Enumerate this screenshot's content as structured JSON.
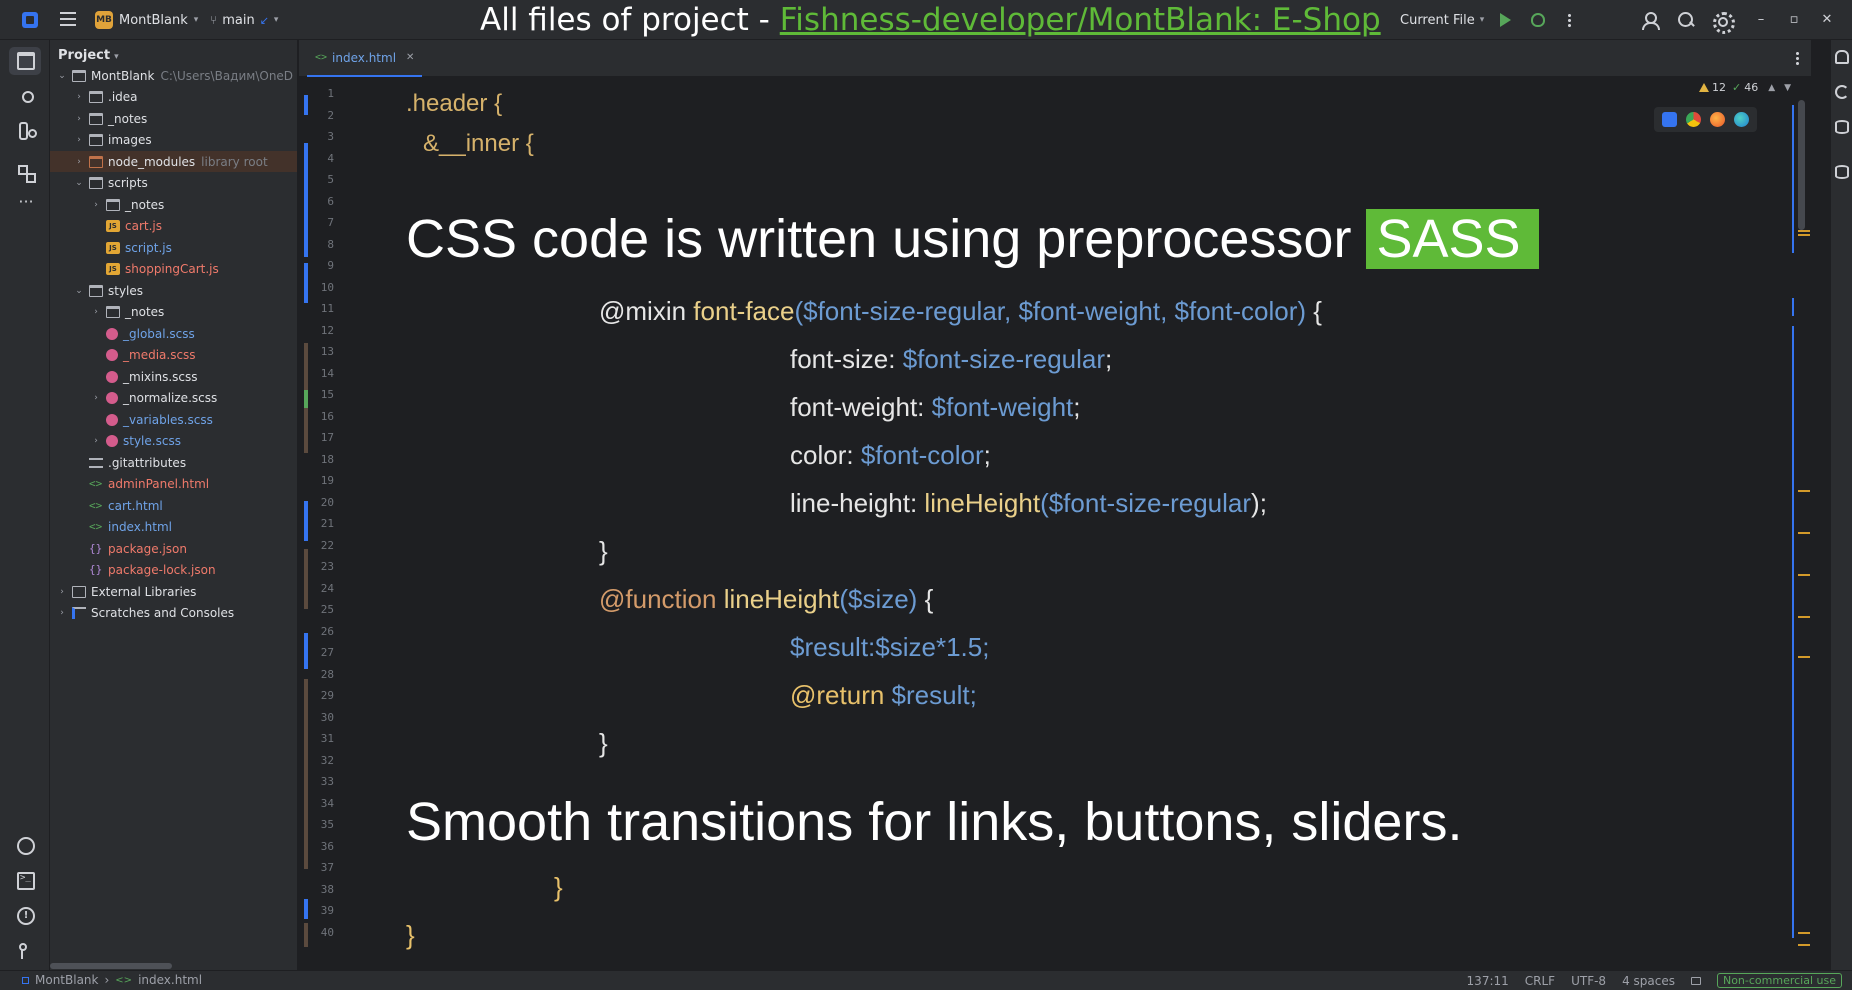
{
  "title": {
    "prefix": "All files of project - ",
    "link": "Fishness-developer/MontBlank: E-Shop"
  },
  "toolbar": {
    "project_badge": "MB",
    "project_name": "MontBlank",
    "branch": "main",
    "run_config": "Current File"
  },
  "project_panel": {
    "header": "Project",
    "tree": [
      {
        "label": "MontBlank",
        "hint": "C:\\Users\\Вадим\\OneD",
        "type": "folder",
        "depth": 0,
        "arrow": "open",
        "color": "normal"
      },
      {
        "label": ".idea",
        "type": "folder",
        "depth": 1,
        "arrow": "closed",
        "color": "normal"
      },
      {
        "label": "_notes",
        "type": "folder",
        "depth": 1,
        "arrow": "closed",
        "color": "normal"
      },
      {
        "label": "images",
        "type": "folder",
        "depth": 1,
        "arrow": "closed",
        "color": "normal"
      },
      {
        "label": "node_modules",
        "hint": "library root",
        "type": "folder-orange",
        "depth": 1,
        "arrow": "closed",
        "color": "normal",
        "selected": true
      },
      {
        "label": "scripts",
        "type": "folder",
        "depth": 1,
        "arrow": "open",
        "color": "normal"
      },
      {
        "label": "_notes",
        "type": "folder",
        "depth": 2,
        "arrow": "closed",
        "color": "normal"
      },
      {
        "label": "cart.js",
        "type": "js",
        "depth": 2,
        "arrow": "none",
        "color": "red"
      },
      {
        "label": "script.js",
        "type": "js",
        "depth": 2,
        "arrow": "none",
        "color": "blue"
      },
      {
        "label": "shoppingCart.js",
        "type": "js",
        "depth": 2,
        "arrow": "none",
        "color": "red"
      },
      {
        "label": "styles",
        "type": "folder",
        "depth": 1,
        "arrow": "open",
        "color": "normal"
      },
      {
        "label": "_notes",
        "type": "folder",
        "depth": 2,
        "arrow": "closed",
        "color": "normal"
      },
      {
        "label": "_global.scss",
        "type": "scss",
        "depth": 2,
        "arrow": "none",
        "color": "blue"
      },
      {
        "label": "_media.scss",
        "type": "scss",
        "depth": 2,
        "arrow": "none",
        "color": "red"
      },
      {
        "label": "_mixins.scss",
        "type": "scss",
        "depth": 2,
        "arrow": "none",
        "color": "normal"
      },
      {
        "label": "_normalize.scss",
        "type": "scss",
        "depth": 2,
        "arrow": "closed",
        "color": "normal"
      },
      {
        "label": "_variables.scss",
        "type": "scss",
        "depth": 2,
        "arrow": "none",
        "color": "blue"
      },
      {
        "label": "style.scss",
        "type": "scss",
        "depth": 2,
        "arrow": "closed",
        "color": "blue"
      },
      {
        "label": ".gitattributes",
        "type": "lines",
        "depth": 1,
        "arrow": "none",
        "color": "normal"
      },
      {
        "label": "adminPanel.html",
        "type": "html",
        "depth": 1,
        "arrow": "none",
        "color": "red"
      },
      {
        "label": "cart.html",
        "type": "html",
        "depth": 1,
        "arrow": "none",
        "color": "blue"
      },
      {
        "label": "index.html",
        "type": "html",
        "depth": 1,
        "arrow": "none",
        "color": "blue"
      },
      {
        "label": "package.json",
        "type": "json",
        "depth": 1,
        "arrow": "none",
        "color": "red"
      },
      {
        "label": "package-lock.json",
        "type": "json",
        "depth": 1,
        "arrow": "none",
        "color": "red"
      },
      {
        "label": "External Libraries",
        "type": "lib",
        "depth": 0,
        "arrow": "closed",
        "color": "normal"
      },
      {
        "label": "Scratches and Consoles",
        "type": "scratch",
        "depth": 0,
        "arrow": "closed",
        "color": "normal"
      }
    ]
  },
  "tabs": [
    {
      "label": "index.html",
      "icon": "<>",
      "active": true
    }
  ],
  "editor": {
    "line_numbers": [
      "1",
      "2",
      "3",
      "4",
      "5",
      "6",
      "7",
      "8",
      "9",
      "10",
      "11",
      "12",
      "13",
      "14",
      "15",
      "16",
      "17",
      "18",
      "19",
      "20",
      "21",
      "22",
      "23",
      "24",
      "25",
      "26",
      "27",
      "28",
      "29",
      "30",
      "31",
      "32",
      "33",
      "34",
      "35",
      "36",
      "37",
      "38",
      "39",
      "40"
    ],
    "code": {
      "header_sel": ".header {",
      "inner_sel": "&__inner {",
      "mixin_kw": "@mixin ",
      "mixin_name": "font-face",
      "mixin_args": "($font-size-regular, $font-weight, $font-color)",
      "mixin_open": " {",
      "fs_prop": "font-size: ",
      "fs_val": "$font-size-regular",
      "fw_prop": "font-weight: ",
      "fw_val": "$font-weight",
      "color_prop": "color: ",
      "color_val": "$font-color",
      "lh_prop": "line-height: ",
      "lh_fn": "lineHeight",
      "lh_arg": "($font-size-regular",
      "semi": ";",
      "lh_close": ");",
      "close_brace": "}",
      "function_kw": "@function ",
      "function_name": "lineHeight",
      "function_args": "($size)",
      "function_open": " {",
      "result_line": "$result:$size*1.5;",
      "return_kw": "@return ",
      "return_val": "$result;",
      "inner_close": "}",
      "header_close": "}"
    },
    "overlay": {
      "css_text": "CSS code is written using preprocessor",
      "sass_text": "SASS",
      "transitions_text": "Smooth transitions for links, buttons, sliders."
    },
    "inspections": {
      "warnings": "12",
      "ok": "46"
    }
  },
  "statusbar": {
    "crumb_project": "MontBlank",
    "crumb_file": "index.html",
    "position": "137:11",
    "line_sep": "CRLF",
    "encoding": "UTF-8",
    "indent": "4 spaces",
    "license": "Non-commercial use"
  },
  "colors": {
    "accent": "#3574f0",
    "title_link": "#5fba38",
    "sass_highlight": "#5fba38",
    "warning": "#e2b442"
  }
}
